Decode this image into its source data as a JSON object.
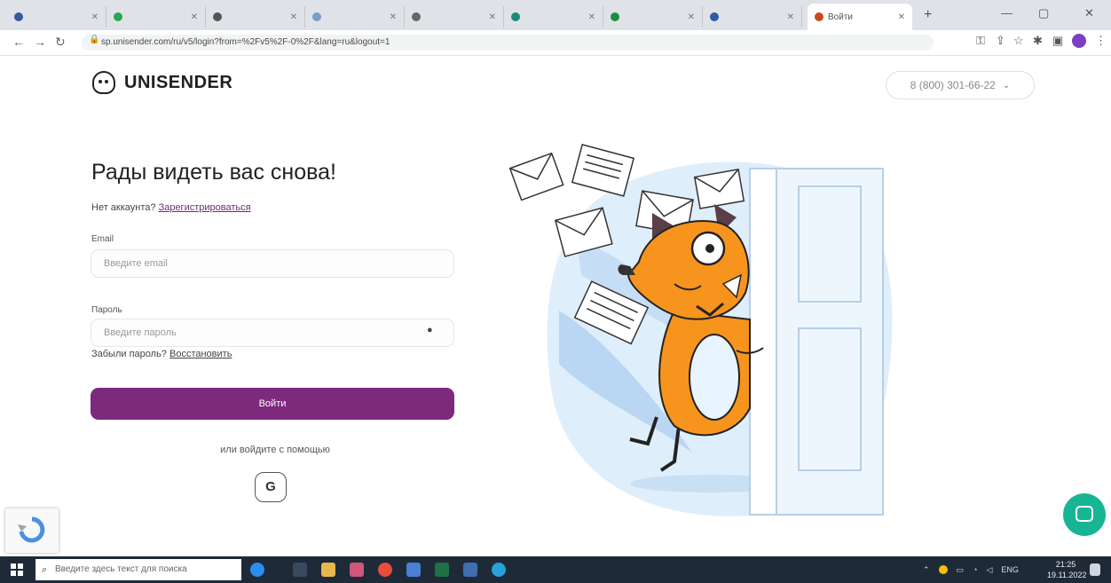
{
  "browser": {
    "tabs": [
      {
        "label": "Войти",
        "favicon_color": "#c94a1c",
        "active": true
      }
    ],
    "url": "sp.unisender.com/ru/v5/login?from=%2Fv5%2F-0%2F&lang=ru&logout=1",
    "colors": {
      "tabbar": "#dfe3e8",
      "profile": "#7b3fc6"
    }
  },
  "header": {
    "brand": "UNISENDER",
    "phone": "8 (800) 301-66-22"
  },
  "login": {
    "title": "Рады видеть вас снова!",
    "no_account": "Нет аккаунта?",
    "register_link": "Зарегистрироваться",
    "email_label": "Email",
    "email_placeholder": "Введите email",
    "password_label": "Пароль",
    "password_placeholder": "Введите пароль",
    "forgot_text": "Забыли пароль?",
    "restore_link": "Восстановить",
    "submit": "Войти",
    "or_with": "или войдите с помощью",
    "google_glyph": "G"
  },
  "taskbar": {
    "search_placeholder": "Введите здесь текст для поиска",
    "language": "ENG",
    "time": "21:25",
    "date": "19.11.2022"
  },
  "colors": {
    "accent": "#7d2a7d",
    "chat": "#18b595",
    "fox": "#f7941d",
    "illustration_bg": "#dfeefb"
  }
}
